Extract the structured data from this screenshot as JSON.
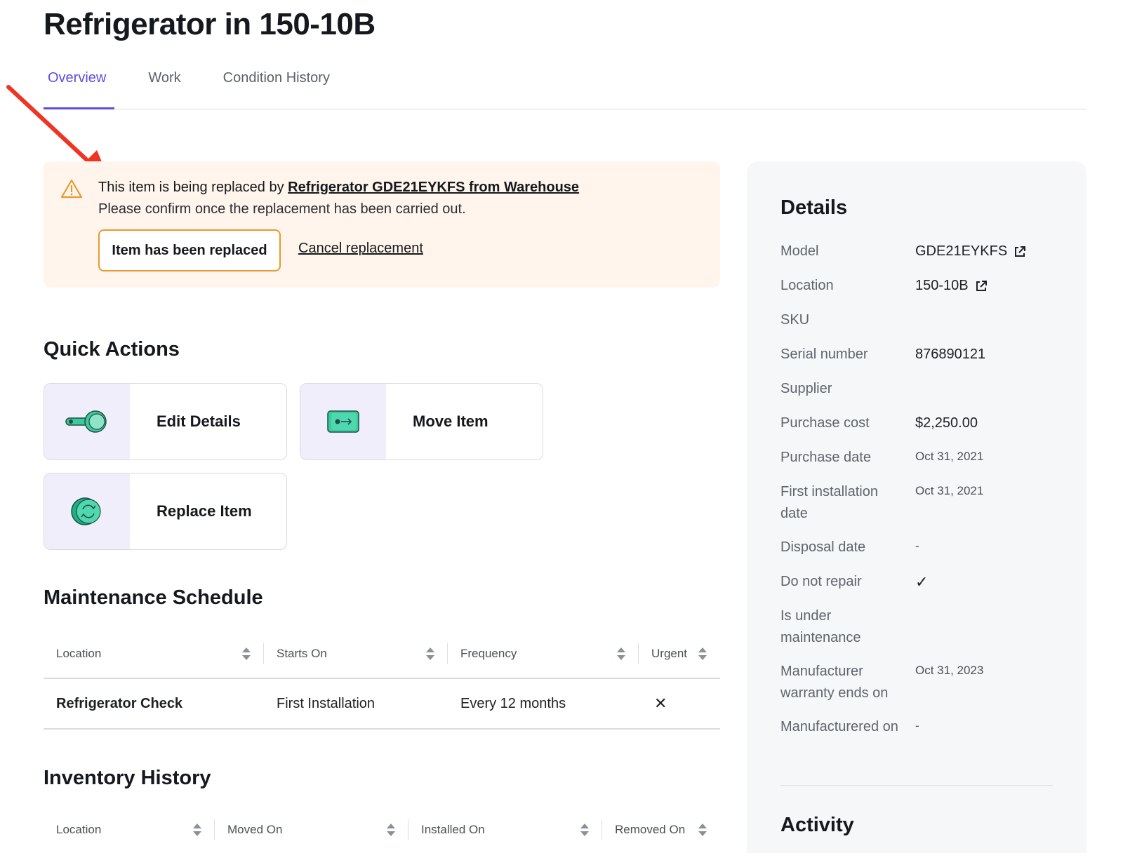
{
  "page": {
    "title": "Refrigerator in 150-10B"
  },
  "tabs": [
    {
      "label": "Overview",
      "active": true
    },
    {
      "label": "Work",
      "active": false
    },
    {
      "label": "Condition History",
      "active": false
    }
  ],
  "banner": {
    "icon": "warning-triangle-icon",
    "text_prefix": "This item is being replaced by ",
    "link_text": "Refrigerator GDE21EYKFS from Warehouse",
    "subtext": "Please confirm once the replacement has been carried out.",
    "confirm_button": "Item has been replaced",
    "cancel_link": "Cancel replacement",
    "background": "#fff5ec",
    "accent": "#e89a2c"
  },
  "quick_actions": {
    "title": "Quick Actions",
    "items": [
      {
        "label": "Edit Details",
        "icon": "toggle-icon"
      },
      {
        "label": "Move Item",
        "icon": "move-arrow-icon"
      },
      {
        "label": "Replace Item",
        "icon": "replace-cycle-icon"
      }
    ]
  },
  "maintenance": {
    "title": "Maintenance Schedule",
    "columns": [
      "Location",
      "Starts On",
      "Frequency",
      "Urgent"
    ],
    "rows": [
      {
        "location": "Refrigerator Check",
        "starts_on": "First Installation",
        "frequency": "Every 12 months",
        "urgent": "✕"
      }
    ]
  },
  "inventory": {
    "title": "Inventory History",
    "columns": [
      "Location",
      "Moved On",
      "Installed On",
      "Removed On"
    ]
  },
  "details": {
    "title": "Details",
    "rows": [
      {
        "label": "Model",
        "value": "GDE21EYKFS"
      },
      {
        "label": "Location",
        "value": "150-10B"
      },
      {
        "label": "SKU",
        "value": ""
      },
      {
        "label": "Serial number",
        "value": "876890121"
      },
      {
        "label": "Supplier",
        "value": ""
      },
      {
        "label": "Purchase cost",
        "value": "$2,250.00"
      },
      {
        "label": "Purchase date",
        "value": "Oct 31, 2021"
      },
      {
        "label": "First installation date",
        "value": "Oct 31, 2021"
      },
      {
        "label": "Disposal date",
        "value": "-"
      },
      {
        "label": "Do not repair",
        "value": "✓"
      },
      {
        "label": "Is under maintenance",
        "value": ""
      },
      {
        "label": "Manufacturer warranty ends on",
        "value": "Oct 31, 2023"
      },
      {
        "label": "Manufacturered on",
        "value": "-"
      }
    ]
  },
  "activity": {
    "title": "Activity"
  },
  "colors": {
    "accent": "#5b4ee0",
    "warning": "#e89a2c",
    "teal": "#3cc9a0",
    "annotation_arrow": "#ee3524"
  }
}
